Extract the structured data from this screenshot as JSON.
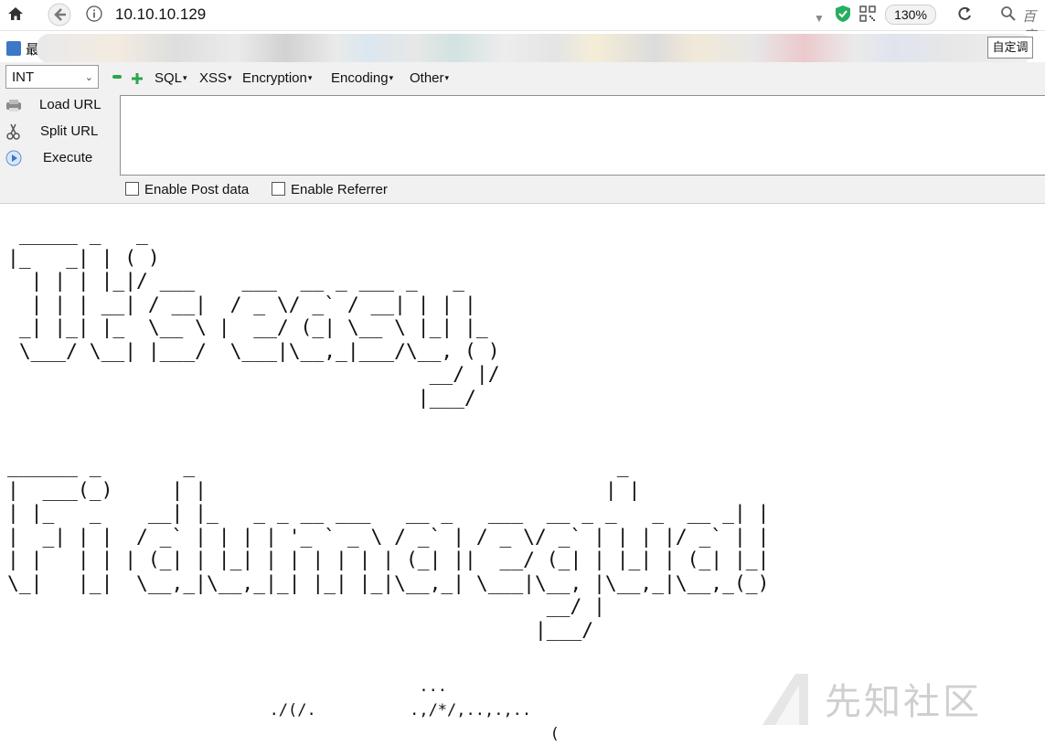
{
  "browser": {
    "url": "10.10.10.129",
    "zoom": "130%",
    "search_placeholder": "百度",
    "bookmark_stub": "最",
    "bookmark_btn": "自定调"
  },
  "hackbar": {
    "select_value": "INT",
    "menus": [
      "SQL",
      "XSS",
      "Encryption",
      "Encoding",
      "Other"
    ],
    "actions": [
      "Load URL",
      "Split URL",
      "Execute"
    ],
    "checkboxes": [
      "Enable Post data",
      "Enable Referrer"
    ]
  },
  "page": {
    "art_line1": " _____ _   _\n|_   _| | ( )\n  | | | |_|/ ___    ___  __ _ ___ _   _\n  | | | __| / __|  / _ \\/ _` / __| | | |\n _| |_| |_  \\__ \\ |  __/ (_| \\__ \\ |_| |_\n \\___/ \\__| |___/  \\___|\\__,_|___/\\__, ( )\n                                    __/ |/\n                                   |___/",
    "art_line2": "______ _       _                                    _\n|  ___(_)     | |                                  | |\n| |_   _    __| |_   _ _ __ ___   __ _   ___  __ _ _   _  __ _| |\n|  _| | |  / _` | | | | '_ ` _ \\ / _` | / _ \\/ _` | | | |/ _` | |\n| |   | | | (_| | |_| | | | | | | (_| ||  __/ (_| | |_| | (_| |_|\n\\_|   |_|  \\__,_|\\__,_|_| |_| |_|\\__,_| \\___|\\__, |\\__,_|\\__,_(_)\n                                              __/ |\n                                             |___/",
    "art_line3": "                                            ...\n                            ./(/.          .,/*/,..,.,..\n                                                          (",
    "watermark": "先知社区"
  }
}
